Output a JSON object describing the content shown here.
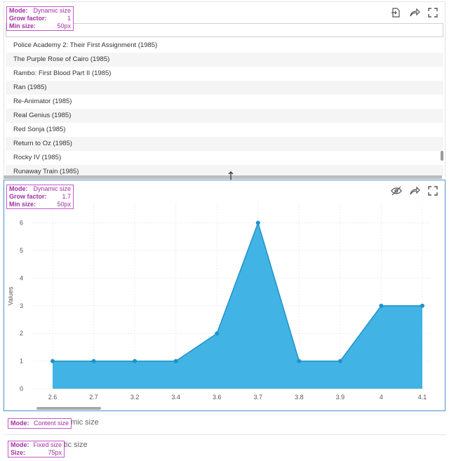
{
  "panel_list": {
    "badge": {
      "mode_label": "Mode:",
      "mode_value": "Dynamic size",
      "grow_label": "Grow factor:",
      "grow_value": "1",
      "min_label": "Min size:",
      "min_value": "50px"
    },
    "toolbar": [
      "export-icon",
      "share-icon",
      "fullscreen-icon"
    ],
    "rows": [
      "Police Academy 2: Their First Assignment (1985)",
      "The Purple Rose of Cairo (1985)",
      "Rambo: First Blood Part II (1985)",
      "Ran (1985)",
      "Re-Animator (1985)",
      "Real Genius (1985)",
      "Red Sonja (1985)",
      "Return to Oz (1985)",
      "Rocky IV (1985)",
      "Runaway Train (1985)"
    ]
  },
  "panel_chart": {
    "badge": {
      "mode_label": "Mode:",
      "mode_value": "Dynamic size",
      "grow_label": "Grow factor:",
      "grow_value": "1.7",
      "min_label": "Min size:",
      "min_value": "50px"
    },
    "toolbar": [
      "hide-icon",
      "share-icon",
      "fullscreen-icon"
    ]
  },
  "chart_data": {
    "type": "area",
    "x": [
      "2.6",
      "2.7",
      "3.2",
      "3.4",
      "3.6",
      "3.7",
      "3.8",
      "3.9",
      "4",
      "4.1"
    ],
    "values": [
      1,
      1,
      1,
      1,
      2,
      6,
      1,
      1,
      3,
      3
    ],
    "ylabel": "Values",
    "yticks": [
      0,
      1,
      2,
      3,
      4,
      5,
      6
    ],
    "ylim": [
      0,
      6.7
    ],
    "grid": true,
    "color": "#41b3e4",
    "line_color": "#1f93c8"
  },
  "panel_content": {
    "badge": {
      "mode_label": "Mode:",
      "mode_value": "Content size"
    },
    "under_text": "mic size"
  },
  "panel_fixed": {
    "badge": {
      "mode_label": "Mode:",
      "mode_value": "Fixed size",
      "size_label": "Size:",
      "size_value": "75px"
    },
    "under_text": "tic size"
  }
}
